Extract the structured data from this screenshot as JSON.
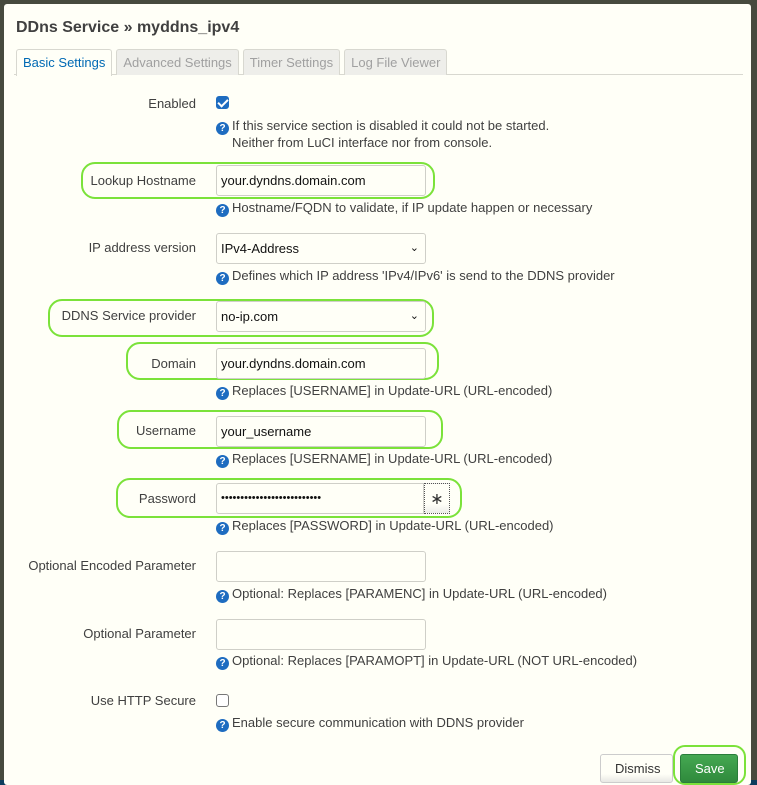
{
  "modal": {
    "title": "DDns Service » myddns_ipv4"
  },
  "tabs": [
    {
      "label": "Basic Settings",
      "active": true
    },
    {
      "label": "Advanced Settings",
      "active": false
    },
    {
      "label": "Timer Settings",
      "active": false
    },
    {
      "label": "Log File Viewer",
      "active": false
    }
  ],
  "fields": {
    "enabled": {
      "label": "Enabled",
      "checked": true,
      "help_line1": "If this service section is disabled it could not be started.",
      "help_line2": "Neither from LuCI interface nor from console."
    },
    "lookup_hostname": {
      "label": "Lookup Hostname",
      "value": "your.dyndns.domain.com",
      "help": "Hostname/FQDN to validate, if IP update happen or necessary"
    },
    "ip_version": {
      "label": "IP address version",
      "value": "IPv4-Address",
      "help": "Defines which IP address 'IPv4/IPv6' is send to the DDNS provider"
    },
    "service_provider": {
      "label": "DDNS Service provider",
      "value": "no-ip.com"
    },
    "domain": {
      "label": "Domain",
      "value": "your.dyndns.domain.com",
      "help": "Replaces [USERNAME] in Update-URL (URL-encoded)"
    },
    "username": {
      "label": "Username",
      "value": "your_username",
      "help": "Replaces [USERNAME] in Update-URL (URL-encoded)"
    },
    "password": {
      "label": "Password",
      "value": "••••••••••••••••••••••••••",
      "reveal_glyph": "∗",
      "help": "Replaces [PASSWORD] in Update-URL (URL-encoded)"
    },
    "param_enc": {
      "label": "Optional Encoded Parameter",
      "value": "",
      "help": "Optional: Replaces [PARAMENC] in Update-URL (URL-encoded)"
    },
    "param_opt": {
      "label": "Optional Parameter",
      "value": "",
      "help": "Optional: Replaces [PARAMOPT] in Update-URL (NOT URL-encoded)"
    },
    "use_https": {
      "label": "Use HTTP Secure",
      "checked": false,
      "help": "Enable secure communication with DDNS provider"
    }
  },
  "help_icon_glyph": "?",
  "select_chevron": "⌄",
  "buttons": {
    "dismiss": "Dismiss",
    "save": "Save"
  },
  "colors": {
    "accent": "#0069b4",
    "highlight": "#7be23a",
    "save": "#2f8a3c"
  }
}
